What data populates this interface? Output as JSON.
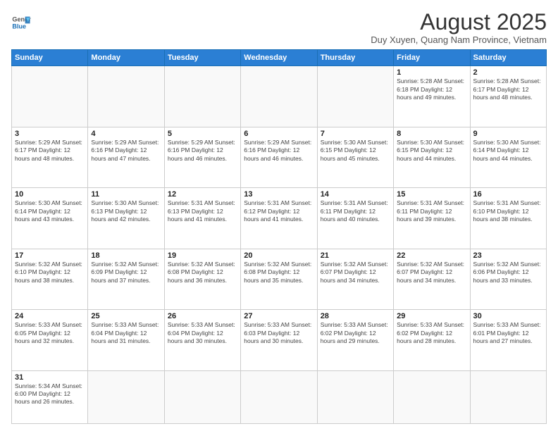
{
  "header": {
    "logo_line1": "General",
    "logo_line2": "Blue",
    "month_title": "August 2025",
    "subtitle": "Duy Xuyen, Quang Nam Province, Vietnam"
  },
  "weekdays": [
    "Sunday",
    "Monday",
    "Tuesday",
    "Wednesday",
    "Thursday",
    "Friday",
    "Saturday"
  ],
  "weeks": [
    [
      {
        "day": "",
        "info": ""
      },
      {
        "day": "",
        "info": ""
      },
      {
        "day": "",
        "info": ""
      },
      {
        "day": "",
        "info": ""
      },
      {
        "day": "",
        "info": ""
      },
      {
        "day": "1",
        "info": "Sunrise: 5:28 AM\nSunset: 6:18 PM\nDaylight: 12 hours\nand 49 minutes."
      },
      {
        "day": "2",
        "info": "Sunrise: 5:28 AM\nSunset: 6:17 PM\nDaylight: 12 hours\nand 48 minutes."
      }
    ],
    [
      {
        "day": "3",
        "info": "Sunrise: 5:29 AM\nSunset: 6:17 PM\nDaylight: 12 hours\nand 48 minutes."
      },
      {
        "day": "4",
        "info": "Sunrise: 5:29 AM\nSunset: 6:16 PM\nDaylight: 12 hours\nand 47 minutes."
      },
      {
        "day": "5",
        "info": "Sunrise: 5:29 AM\nSunset: 6:16 PM\nDaylight: 12 hours\nand 46 minutes."
      },
      {
        "day": "6",
        "info": "Sunrise: 5:29 AM\nSunset: 6:16 PM\nDaylight: 12 hours\nand 46 minutes."
      },
      {
        "day": "7",
        "info": "Sunrise: 5:30 AM\nSunset: 6:15 PM\nDaylight: 12 hours\nand 45 minutes."
      },
      {
        "day": "8",
        "info": "Sunrise: 5:30 AM\nSunset: 6:15 PM\nDaylight: 12 hours\nand 44 minutes."
      },
      {
        "day": "9",
        "info": "Sunrise: 5:30 AM\nSunset: 6:14 PM\nDaylight: 12 hours\nand 44 minutes."
      }
    ],
    [
      {
        "day": "10",
        "info": "Sunrise: 5:30 AM\nSunset: 6:14 PM\nDaylight: 12 hours\nand 43 minutes."
      },
      {
        "day": "11",
        "info": "Sunrise: 5:30 AM\nSunset: 6:13 PM\nDaylight: 12 hours\nand 42 minutes."
      },
      {
        "day": "12",
        "info": "Sunrise: 5:31 AM\nSunset: 6:13 PM\nDaylight: 12 hours\nand 41 minutes."
      },
      {
        "day": "13",
        "info": "Sunrise: 5:31 AM\nSunset: 6:12 PM\nDaylight: 12 hours\nand 41 minutes."
      },
      {
        "day": "14",
        "info": "Sunrise: 5:31 AM\nSunset: 6:11 PM\nDaylight: 12 hours\nand 40 minutes."
      },
      {
        "day": "15",
        "info": "Sunrise: 5:31 AM\nSunset: 6:11 PM\nDaylight: 12 hours\nand 39 minutes."
      },
      {
        "day": "16",
        "info": "Sunrise: 5:31 AM\nSunset: 6:10 PM\nDaylight: 12 hours\nand 38 minutes."
      }
    ],
    [
      {
        "day": "17",
        "info": "Sunrise: 5:32 AM\nSunset: 6:10 PM\nDaylight: 12 hours\nand 38 minutes."
      },
      {
        "day": "18",
        "info": "Sunrise: 5:32 AM\nSunset: 6:09 PM\nDaylight: 12 hours\nand 37 minutes."
      },
      {
        "day": "19",
        "info": "Sunrise: 5:32 AM\nSunset: 6:08 PM\nDaylight: 12 hours\nand 36 minutes."
      },
      {
        "day": "20",
        "info": "Sunrise: 5:32 AM\nSunset: 6:08 PM\nDaylight: 12 hours\nand 35 minutes."
      },
      {
        "day": "21",
        "info": "Sunrise: 5:32 AM\nSunset: 6:07 PM\nDaylight: 12 hours\nand 34 minutes."
      },
      {
        "day": "22",
        "info": "Sunrise: 5:32 AM\nSunset: 6:07 PM\nDaylight: 12 hours\nand 34 minutes."
      },
      {
        "day": "23",
        "info": "Sunrise: 5:32 AM\nSunset: 6:06 PM\nDaylight: 12 hours\nand 33 minutes."
      }
    ],
    [
      {
        "day": "24",
        "info": "Sunrise: 5:33 AM\nSunset: 6:05 PM\nDaylight: 12 hours\nand 32 minutes."
      },
      {
        "day": "25",
        "info": "Sunrise: 5:33 AM\nSunset: 6:04 PM\nDaylight: 12 hours\nand 31 minutes."
      },
      {
        "day": "26",
        "info": "Sunrise: 5:33 AM\nSunset: 6:04 PM\nDaylight: 12 hours\nand 30 minutes."
      },
      {
        "day": "27",
        "info": "Sunrise: 5:33 AM\nSunset: 6:03 PM\nDaylight: 12 hours\nand 30 minutes."
      },
      {
        "day": "28",
        "info": "Sunrise: 5:33 AM\nSunset: 6:02 PM\nDaylight: 12 hours\nand 29 minutes."
      },
      {
        "day": "29",
        "info": "Sunrise: 5:33 AM\nSunset: 6:02 PM\nDaylight: 12 hours\nand 28 minutes."
      },
      {
        "day": "30",
        "info": "Sunrise: 5:33 AM\nSunset: 6:01 PM\nDaylight: 12 hours\nand 27 minutes."
      }
    ],
    [
      {
        "day": "31",
        "info": "Sunrise: 5:34 AM\nSunset: 6:00 PM\nDaylight: 12 hours\nand 26 minutes."
      },
      {
        "day": "",
        "info": ""
      },
      {
        "day": "",
        "info": ""
      },
      {
        "day": "",
        "info": ""
      },
      {
        "day": "",
        "info": ""
      },
      {
        "day": "",
        "info": ""
      },
      {
        "day": "",
        "info": ""
      }
    ]
  ]
}
